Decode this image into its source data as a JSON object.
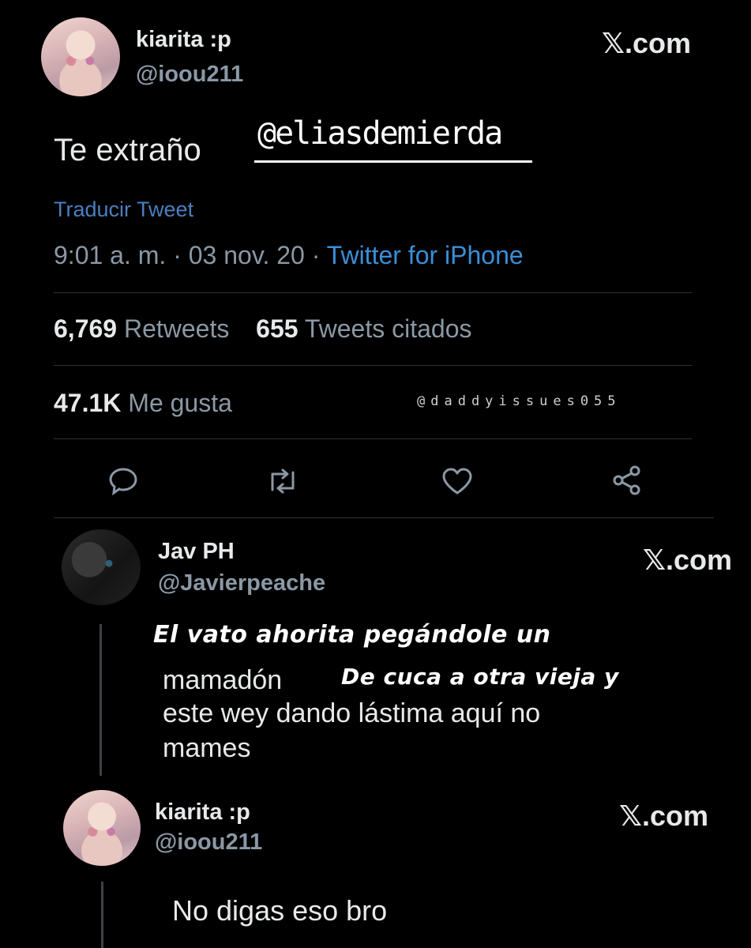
{
  "tweet1": {
    "display_name": "kiarita :p",
    "handle": "@ioou211",
    "brand": "𝕏.com",
    "text": "Te extraño",
    "mention_overlay": "@eliasdemierda",
    "translate_label": "Traducir Tweet",
    "timestamp": "9:01 a. m. · 03 nov. 20 ·",
    "source": "Twitter for iPhone",
    "retweets_count": "6,769",
    "retweets_label": "Retweets",
    "quotes_count": "655",
    "quotes_label": "Tweets citados",
    "likes_count": "47.1K",
    "likes_label": "Me gusta",
    "watermark": "@daddyissues055",
    "actions": [
      "reply-icon",
      "retweet-icon",
      "like-icon",
      "share-icon"
    ]
  },
  "reply1": {
    "display_name": "Jav PH",
    "handle": "@Javierpeache",
    "brand": "𝕏.com",
    "overlay_line1": "El vato ahorita pegándole un",
    "text_word1": "mamadón",
    "overlay_line2": "De cuca a otra vieja y",
    "text_line2": "este wey dando lástima aquí no",
    "text_line3": "mames"
  },
  "reply2": {
    "display_name": "kiarita :p",
    "handle": "@ioou211",
    "brand": "𝕏.com",
    "text": "No digas eso bro"
  },
  "colors": {
    "background": "#000000",
    "text": "#e7e9ea",
    "muted": "#8b98a5",
    "link": "#1d9bf0",
    "divider": "#2f3336"
  }
}
